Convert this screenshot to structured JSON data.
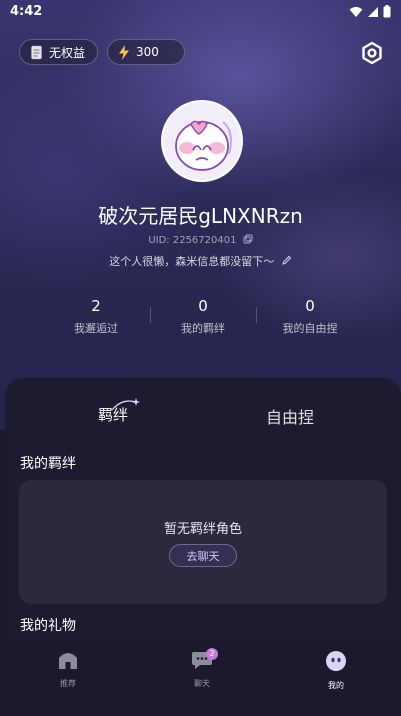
{
  "status_bar": {
    "time": "4:42"
  },
  "header": {
    "benefits_label": "无权益",
    "energy_value": "300"
  },
  "profile": {
    "username": "破次元居民gLNXNRzn",
    "uid": "UID: 2256720401",
    "bio": "这个人很懒，森米信息都没留下～"
  },
  "stats": [
    {
      "value": "2",
      "label": "我邂逅过"
    },
    {
      "value": "0",
      "label": "我的羁绊"
    },
    {
      "value": "0",
      "label": "我的自由捏"
    }
  ],
  "tabs": [
    {
      "label": "羁绊",
      "active": true
    },
    {
      "label": "自由捏",
      "active": false
    }
  ],
  "sections": {
    "bonds_title": "我的羁绊",
    "empty_text": "暂无羁绊角色",
    "chat_button": "去聊天",
    "gifts_title": "我的礼物"
  },
  "bottom_nav": [
    {
      "label": "推荐",
      "icon": "home-icon"
    },
    {
      "label": "聊天",
      "icon": "chat-icon",
      "badge": "2"
    },
    {
      "label": "我的",
      "icon": "profile-face-icon",
      "active": true
    }
  ],
  "colors": {
    "accent": "#c77ad8",
    "sheet": "#1d1b2f",
    "card": "#2b293e"
  }
}
